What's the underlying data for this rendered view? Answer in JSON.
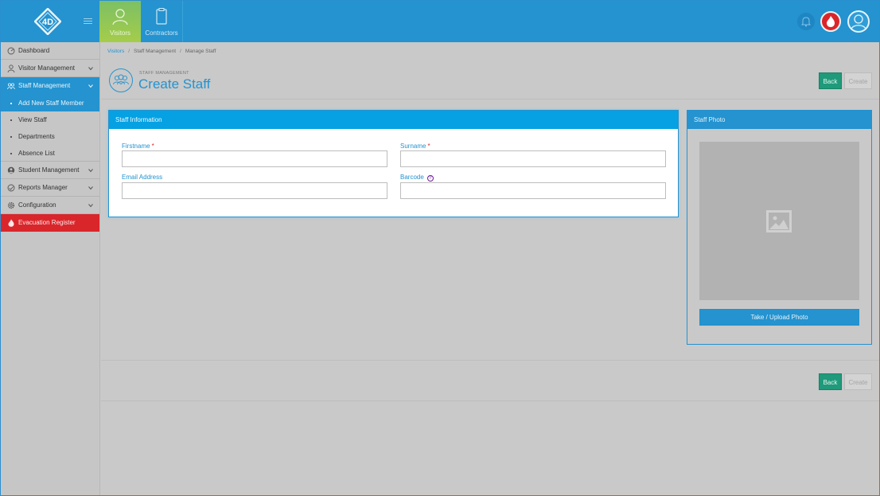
{
  "topnav": {
    "tabs": [
      {
        "label": "Visitors",
        "icon": "person-icon",
        "active": true
      },
      {
        "label": "Contractors",
        "icon": "clipboard-icon",
        "active": false
      }
    ]
  },
  "sidebar": {
    "items": [
      {
        "label": "Dashboard",
        "icon": "dashboard-icon"
      },
      {
        "label": "Visitor Management",
        "icon": "person-icon"
      },
      {
        "label": "Staff Management",
        "icon": "group-icon"
      },
      {
        "label": "Add New Staff Member"
      },
      {
        "label": "View Staff"
      },
      {
        "label": "Departments"
      },
      {
        "label": "Absence List"
      },
      {
        "label": "Student Management",
        "icon": "student-icon"
      },
      {
        "label": "Reports Manager",
        "icon": "reports-icon"
      },
      {
        "label": "Configuration",
        "icon": "gear-icon"
      },
      {
        "label": "Evacuation Register",
        "icon": "fire-icon"
      }
    ]
  },
  "breadcrumb": {
    "home": "Visitors",
    "section": "Staff Management",
    "current": "Manage Staff"
  },
  "page": {
    "kicker": "STAFF MANAGEMENT",
    "title": "Create Staff",
    "back_label": "Back",
    "create_label": "Create"
  },
  "staff_info": {
    "header": "Staff Information",
    "firstname_label": "Firstname",
    "surname_label": "Surname",
    "email_label": "Email Address",
    "barcode_label": "Barcode",
    "required_mark": "*",
    "help_mark": "?",
    "firstname_value": "",
    "surname_value": "",
    "email_value": "",
    "barcode_value": ""
  },
  "photo": {
    "header": "Staff Photo",
    "upload_label": "Take / Upload Photo"
  },
  "colors": {
    "primary": "#2493cf",
    "header_bright": "#05a1e2",
    "back": "#1f9a7a",
    "danger": "#d9262b",
    "visitors_tab": "#8cc456"
  }
}
